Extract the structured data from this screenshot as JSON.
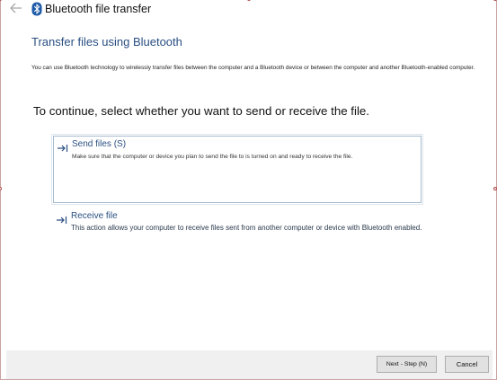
{
  "window": {
    "title": "Bluetooth file transfer",
    "icons": {
      "back": "back-arrow-icon",
      "app": "bluetooth-icon"
    }
  },
  "main": {
    "heading": "Transfer files using Bluetooth",
    "intro": "You can use Bluetooth technology to wirelessly transfer files between the computer and a Bluetooth device or between the computer and another Bluetooth-enabled computer.",
    "prompt": "To continue, select whether you want to send or receive the file.",
    "options": [
      {
        "title": "Send files (S)",
        "description": "Make sure that the computer or device you plan to send the file to is turned on and ready to receive the file.",
        "selected": true
      },
      {
        "title": "Receive file",
        "description": "This action allows your computer to receive files sent from another computer or device with Bluetooth enabled.",
        "selected": false
      }
    ]
  },
  "footer": {
    "next_label": "Next - Step (N)",
    "cancel_label": "Cancel"
  },
  "colors": {
    "heading": "#2a4f82",
    "option_border": "#a6bbd0",
    "footer_bg": "#f0f0f0",
    "window_border": "#c9a3a3"
  }
}
